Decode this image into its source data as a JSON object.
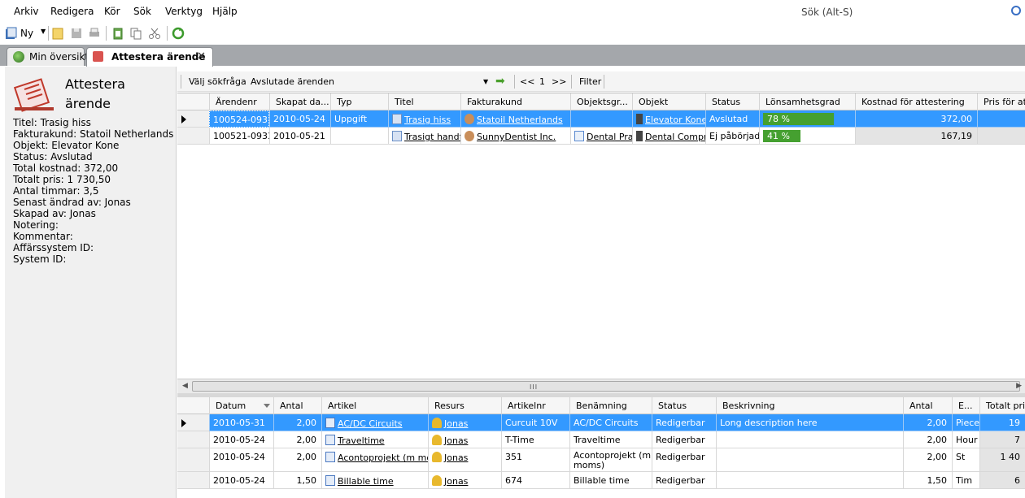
{
  "menu": [
    "Arkiv",
    "Redigera",
    "Kör",
    "Sök",
    "Verktyg",
    "Hjälp"
  ],
  "search": {
    "placeholder": "Sök  (Alt-S)"
  },
  "toolbar": {
    "new_label": "Ny"
  },
  "tabs": [
    {
      "label": "Min översikt"
    },
    {
      "label": "Attestera ärende"
    }
  ],
  "panel": {
    "title": "Attestera ärende",
    "fields": [
      "Titel: Trasig hiss",
      "Fakturakund: Statoil Netherlands",
      "Objekt: Elevator Kone",
      "Status: Avslutad",
      "Total kostnad: 372,00",
      "Totalt pris: 1 730,50",
      "Antal timmar: 3,5",
      "Senast ändrad av: Jonas",
      "Skapad av: Jonas",
      "Notering:",
      "Kommentar:",
      "Affärssystem ID:",
      "System ID:"
    ]
  },
  "query": {
    "label": "Välj sökfråga",
    "value": "Avslutade ärenden",
    "prev": "<<",
    "page": "1",
    "next": ">>",
    "filter": "Filter"
  },
  "cases": {
    "columns": [
      "Ärendenr",
      "Skapat da...",
      "Typ",
      "Titel",
      "Fakturakund",
      "Objektsgr...",
      "Objekt",
      "Status",
      "Lönsamhetsgrad",
      "Kostnad för attestering",
      "Pris för atte"
    ],
    "rows": [
      {
        "nr": "100524-0937",
        "date": "2010-05-24",
        "type": "Uppgift",
        "title": "Trasig hiss",
        "customer": "Statoil Netherlands",
        "objgroup": "",
        "object": "Elevator Kone",
        "status": "Avslutad",
        "profit": "78 %",
        "profit_value": 0.78,
        "cost": "372,00",
        "price": ""
      },
      {
        "nr": "100521-0933",
        "date": "2010-05-21",
        "type": "",
        "title": "Trasigt handfat",
        "customer": "SunnyDentist Inc.",
        "objgroup": "Dental Practice",
        "object": "Dental Compressor",
        "status": "Ej påbörjad",
        "profit": "41 %",
        "profit_value": 0.41,
        "cost": "167,19",
        "price": ""
      }
    ]
  },
  "articles": {
    "columns": [
      "Datum",
      "Antal",
      "Artikel",
      "Resurs",
      "Artikelnr",
      "Benämning",
      "Status",
      "Beskrivning",
      "Antal",
      "E...",
      "Totalt pris"
    ],
    "rows": [
      {
        "date": "2010-05-31",
        "qty": "2,00",
        "article": "AC/DC Circuits",
        "resource": "Jonas",
        "artno": "Curcuit 10V",
        "name": "AC/DC Circuits",
        "status": "Redigerbar",
        "desc": "Long description here",
        "qty2": "2,00",
        "unit": "Piece",
        "total": "19"
      },
      {
        "date": "2010-05-24",
        "qty": "2,00",
        "article": "Traveltime",
        "resource": "Jonas",
        "artno": "T-Time",
        "name": "Traveltime",
        "status": "Redigerbar",
        "desc": "",
        "qty2": "2,00",
        "unit": "Hour",
        "total": "7"
      },
      {
        "date": "2010-05-24",
        "qty": "2,00",
        "article": "Acontoprojekt (m moms)",
        "resource": "Jonas",
        "artno": "351",
        "name": "Acontoprojekt (m moms)",
        "status": "Redigerbar",
        "desc": "",
        "qty2": "2,00",
        "unit": "St",
        "total": "1 40"
      },
      {
        "date": "2010-05-24",
        "qty": "1,50",
        "article": "Billable time",
        "resource": "Jonas",
        "artno": "674",
        "name": "Billable time",
        "status": "Redigerbar",
        "desc": "",
        "qty2": "1,50",
        "unit": "Tim",
        "total": "6"
      }
    ]
  },
  "colors": {
    "selection": "#3399ff",
    "progress": "#45a030",
    "tabstrip": "#a4a7ab"
  }
}
